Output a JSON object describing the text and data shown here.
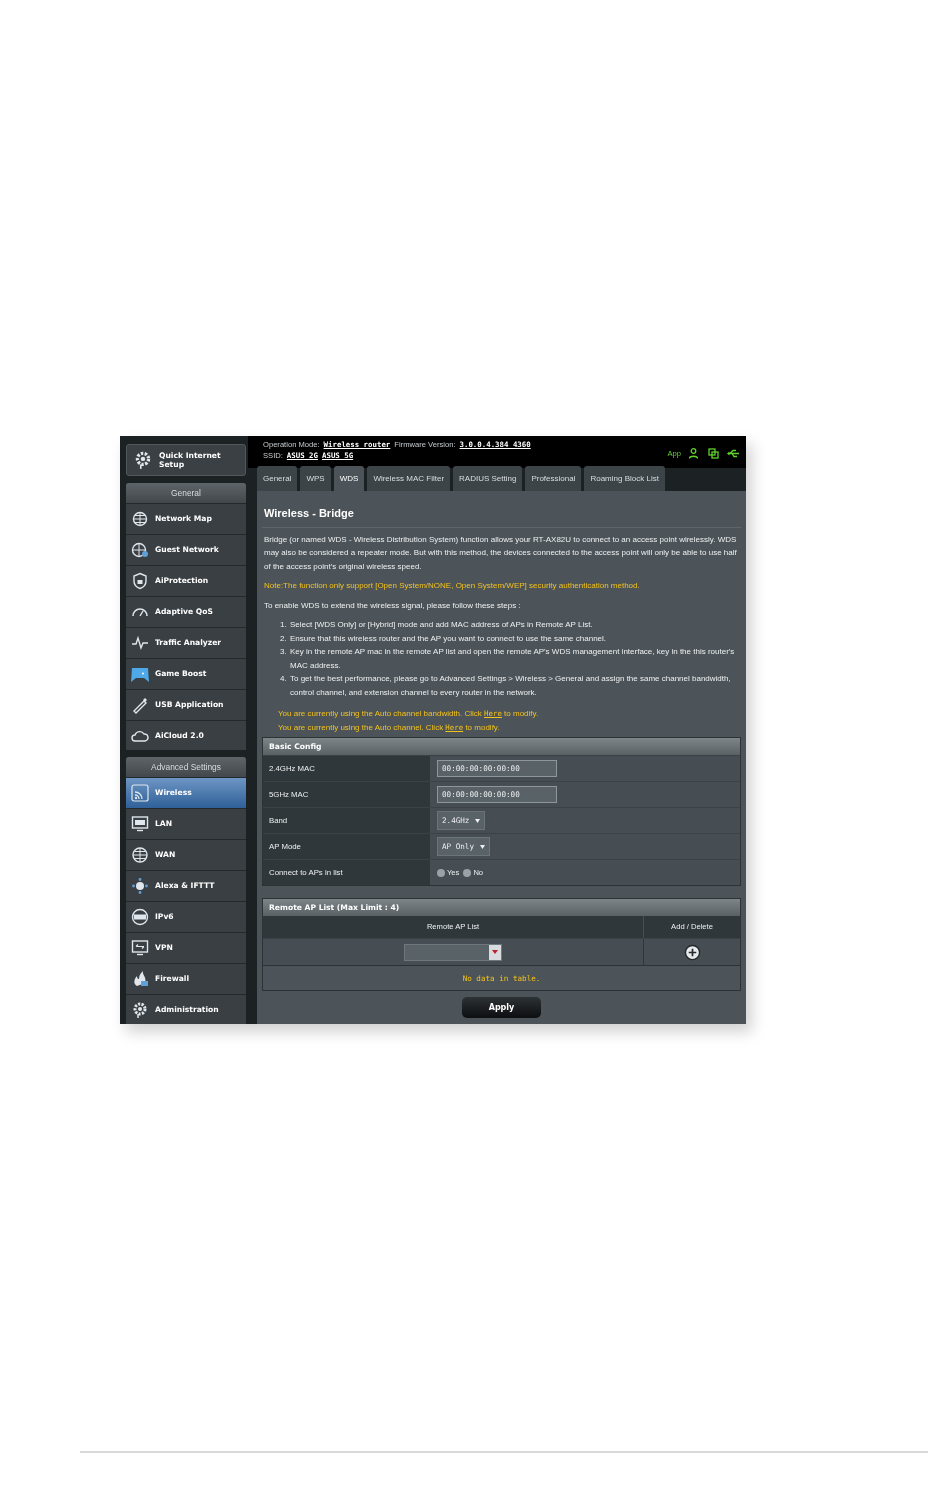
{
  "header": {
    "operation_mode_label": "Operation Mode:",
    "operation_mode": "Wireless router",
    "firmware_label": "Firmware Version:",
    "firmware": "3.0.0.4.384_4360",
    "ssid_label": "SSID:",
    "ssids": [
      "ASUS_2G",
      "ASUS_5G"
    ],
    "app_label": "App"
  },
  "sidebar": {
    "quick_setup": "Quick Internet Setup",
    "sections": [
      {
        "title": "General",
        "items": [
          {
            "label": "Network Map",
            "selected": false
          },
          {
            "label": "Guest Network",
            "selected": false
          },
          {
            "label": "AiProtection",
            "selected": false
          },
          {
            "label": "Adaptive QoS",
            "selected": false
          },
          {
            "label": "Traffic Analyzer",
            "selected": false
          },
          {
            "label": "Game Boost",
            "selected": false
          },
          {
            "label": "USB Application",
            "selected": false
          },
          {
            "label": "AiCloud 2.0",
            "selected": false
          }
        ]
      },
      {
        "title": "Advanced Settings",
        "items": [
          {
            "label": "Wireless",
            "selected": true
          },
          {
            "label": "LAN",
            "selected": false
          },
          {
            "label": "WAN",
            "selected": false
          },
          {
            "label": "Alexa & IFTTT",
            "selected": false
          },
          {
            "label": "IPv6",
            "selected": false
          },
          {
            "label": "VPN",
            "selected": false
          },
          {
            "label": "Firewall",
            "selected": false
          },
          {
            "label": "Administration",
            "selected": false
          }
        ]
      }
    ]
  },
  "tabs": [
    {
      "label": "General",
      "selected": false
    },
    {
      "label": "WPS",
      "selected": false
    },
    {
      "label": "WDS",
      "selected": true
    },
    {
      "label": "Wireless MAC Filter",
      "selected": false
    },
    {
      "label": "RADIUS Setting",
      "selected": false
    },
    {
      "label": "Professional",
      "selected": false
    },
    {
      "label": "Roaming Block List",
      "selected": false
    }
  ],
  "page": {
    "title": "Wireless - Bridge",
    "intro": "Bridge (or named WDS - Wireless Distribution System) function allows your RT-AX82U to connect to an access point wirelessly. WDS may also be considered a repeater mode. But with this method, the devices connected to the access point will only be able to use half of the access point's original wireless speed.",
    "note": "Note:The function only support [Open System/NONE, Open System/WEP] security authentication method.",
    "steps_intro": "To enable WDS to extend the wireless signal, please follow these steps :",
    "steps": [
      {
        "number": "1.",
        "text": "Select [WDS Only] or [Hybrid] mode and add MAC address of APs in Remote AP List."
      },
      {
        "number": "2.",
        "text": "Ensure that this wireless router and the AP you want to connect to use the same channel."
      },
      {
        "number": "3.",
        "text": "Key in the remote AP mac in the remote AP list and open the remote AP's WDS management interface, key in the this router's MAC address."
      },
      {
        "number": "4.",
        "text": "To get the best performance, please go to Advanced Settings > Wireless > General and assign the same channel bandwidth, control channel, and extension channel to every router in the network."
      }
    ],
    "notices": [
      {
        "before": "You are currently using the Auto channel bandwidth. Click ",
        "link": "Here",
        "after": " to modify."
      },
      {
        "before": "You are currently using the Auto channel. Click ",
        "link": "Here",
        "after": " to modify."
      }
    ]
  },
  "basic_config": {
    "title": "Basic Config",
    "rows": [
      {
        "kind": "text",
        "label": "2.4GHz MAC",
        "value": "00:00:00:00:00:00"
      },
      {
        "kind": "text",
        "label": "5GHz MAC",
        "value": "00:00:00:00:00:00"
      },
      {
        "kind": "select",
        "label": "Band",
        "value": "2.4GHz"
      },
      {
        "kind": "select",
        "label": "AP Mode",
        "value": "AP Only"
      },
      {
        "kind": "radio",
        "label": "Connect to APs in list",
        "options": [
          {
            "label": "Yes",
            "selected": false
          },
          {
            "label": "No",
            "selected": false
          }
        ]
      }
    ]
  },
  "remote_ap": {
    "title": "Remote AP List (Max Limit : 4)",
    "columns": [
      "Remote AP List",
      "Add / Delete"
    ],
    "empty": "No data in table."
  },
  "apply": "Apply"
}
